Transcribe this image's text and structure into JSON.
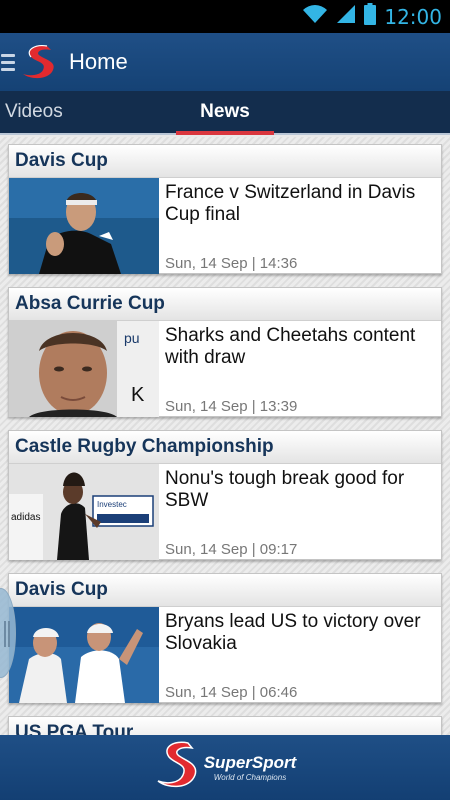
{
  "status_bar": {
    "time": "12:00",
    "icons": [
      "wifi-icon",
      "signal-icon",
      "battery-icon"
    ]
  },
  "action_bar": {
    "title": "Home",
    "icons": [
      "menu-icon",
      "supersport-logo"
    ]
  },
  "tabs": [
    {
      "label": "Videos",
      "selected": false
    },
    {
      "label": "News",
      "selected": true
    }
  ],
  "articles": [
    {
      "category": "Davis Cup",
      "headline": "France v Switzerland in Davis Cup final",
      "date": "Sun, 14 Sep | 14:36"
    },
    {
      "category": "Absa Currie Cup",
      "headline": "Sharks and Cheetahs content with draw",
      "date": "Sun, 14 Sep | 13:39"
    },
    {
      "category": "Castle Rugby Championship",
      "headline": "Nonu's tough break good for SBW",
      "date": "Sun, 14 Sep | 09:17"
    },
    {
      "category": "Davis Cup",
      "headline": "Bryans lead US to victory over Slovakia",
      "date": "Sun, 14 Sep | 06:46"
    },
    {
      "category": "US PGA Tour"
    }
  ],
  "footer": {
    "brand": "SuperSport",
    "tagline": "World of Champions"
  },
  "colors": {
    "action_bar": "#1b4a80",
    "tab_bar": "#132d4d",
    "tab_indicator": "#d9363e",
    "category_text": "#16355a",
    "status_accent": "#33b5e5"
  }
}
